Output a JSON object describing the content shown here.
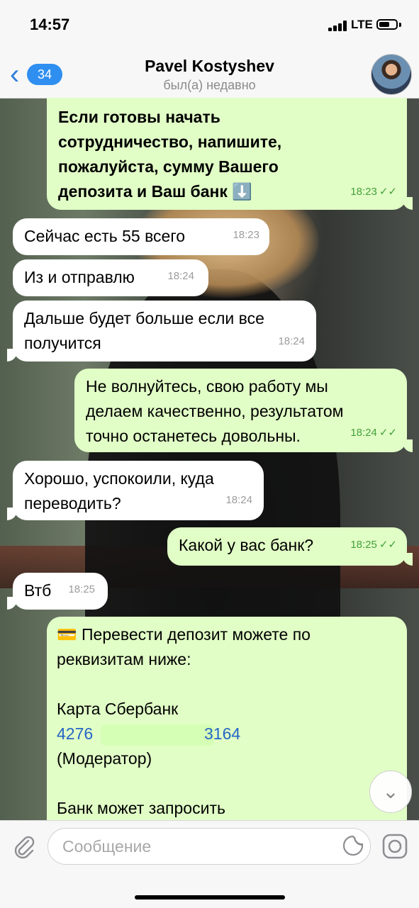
{
  "status": {
    "time": "14:57",
    "network": "LTE"
  },
  "header": {
    "back_count": "34",
    "contact_name": "Pavel Kostyshev",
    "contact_status": "был(а) недавно"
  },
  "messages": [
    {
      "dir": "out",
      "lines": [
        "Если готовы начать",
        "сотрудничество, напишите,",
        "пожалуйста, сумму Вашего",
        "депозита и Ваш банк ⬇️"
      ],
      "time": "18:23",
      "read": true
    },
    {
      "dir": "in",
      "lines": [
        "Сейчас есть 55 всего"
      ],
      "time": "18:23"
    },
    {
      "dir": "in",
      "lines": [
        "Из и отправлю"
      ],
      "time": "18:24"
    },
    {
      "dir": "in",
      "lines": [
        "Дальше будет больше если все",
        "получится"
      ],
      "time": "18:24"
    },
    {
      "dir": "out",
      "lines": [
        "Не волнуйтесь, свою работу мы",
        "делаем качественно, результатом",
        "точно останетесь довольны."
      ],
      "time": "18:24",
      "read": true
    },
    {
      "dir": "in",
      "lines": [
        "Хорошо, успокоили, куда",
        "переводить?"
      ],
      "time": "18:24"
    },
    {
      "dir": "out",
      "lines": [
        "Какой у вас банк?"
      ],
      "time": "18:25",
      "read": true
    },
    {
      "dir": "in",
      "lines": [
        "Втб"
      ],
      "time": "18:25"
    },
    {
      "dir": "out",
      "lines": [
        "💳 Перевести депозит можете по",
        "реквизитам ниже:",
        "",
        "Карта Сбербанк",
        "4276",
        "3164",
        "(Модератор)",
        "",
        "Банк может запросить"
      ]
    }
  ],
  "input": {
    "placeholder": "Сообщение"
  },
  "icons": {
    "back": "chevron-left-icon",
    "attach": "paperclip-icon",
    "sticker": "sticker-icon",
    "camera": "camera-icon",
    "scroll": "chevron-down-icon"
  },
  "colors": {
    "outgoing_bubble": "#e1fec6",
    "incoming_bubble": "#ffffff",
    "accent": "#2f8ff0"
  }
}
